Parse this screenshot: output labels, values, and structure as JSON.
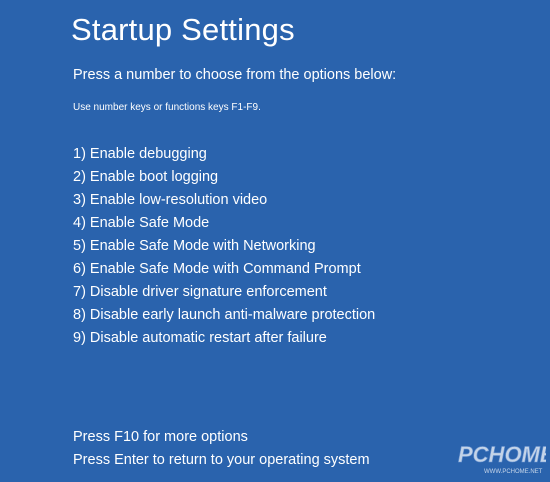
{
  "screen": {
    "title": "Startup Settings",
    "prompt": "Press a number to choose from the options below:",
    "hint": "Use number keys or functions keys F1-F9."
  },
  "options": [
    "1) Enable debugging",
    "2) Enable boot logging",
    "3) Enable low-resolution video",
    "4) Enable Safe Mode",
    "5) Enable Safe Mode with Networking",
    "6) Enable Safe Mode with Command Prompt",
    "7) Disable driver signature enforcement",
    "8) Disable early launch anti-malware protection",
    "9) Disable automatic restart after failure"
  ],
  "footer": {
    "more_options": "Press F10 for more options",
    "return": "Press Enter to return to your operating system"
  },
  "watermark": {
    "brand": "PCHOME",
    "url": "WWW.PCHOME.NET"
  },
  "colors": {
    "background": "#2a63ad",
    "text": "#ffffff"
  }
}
